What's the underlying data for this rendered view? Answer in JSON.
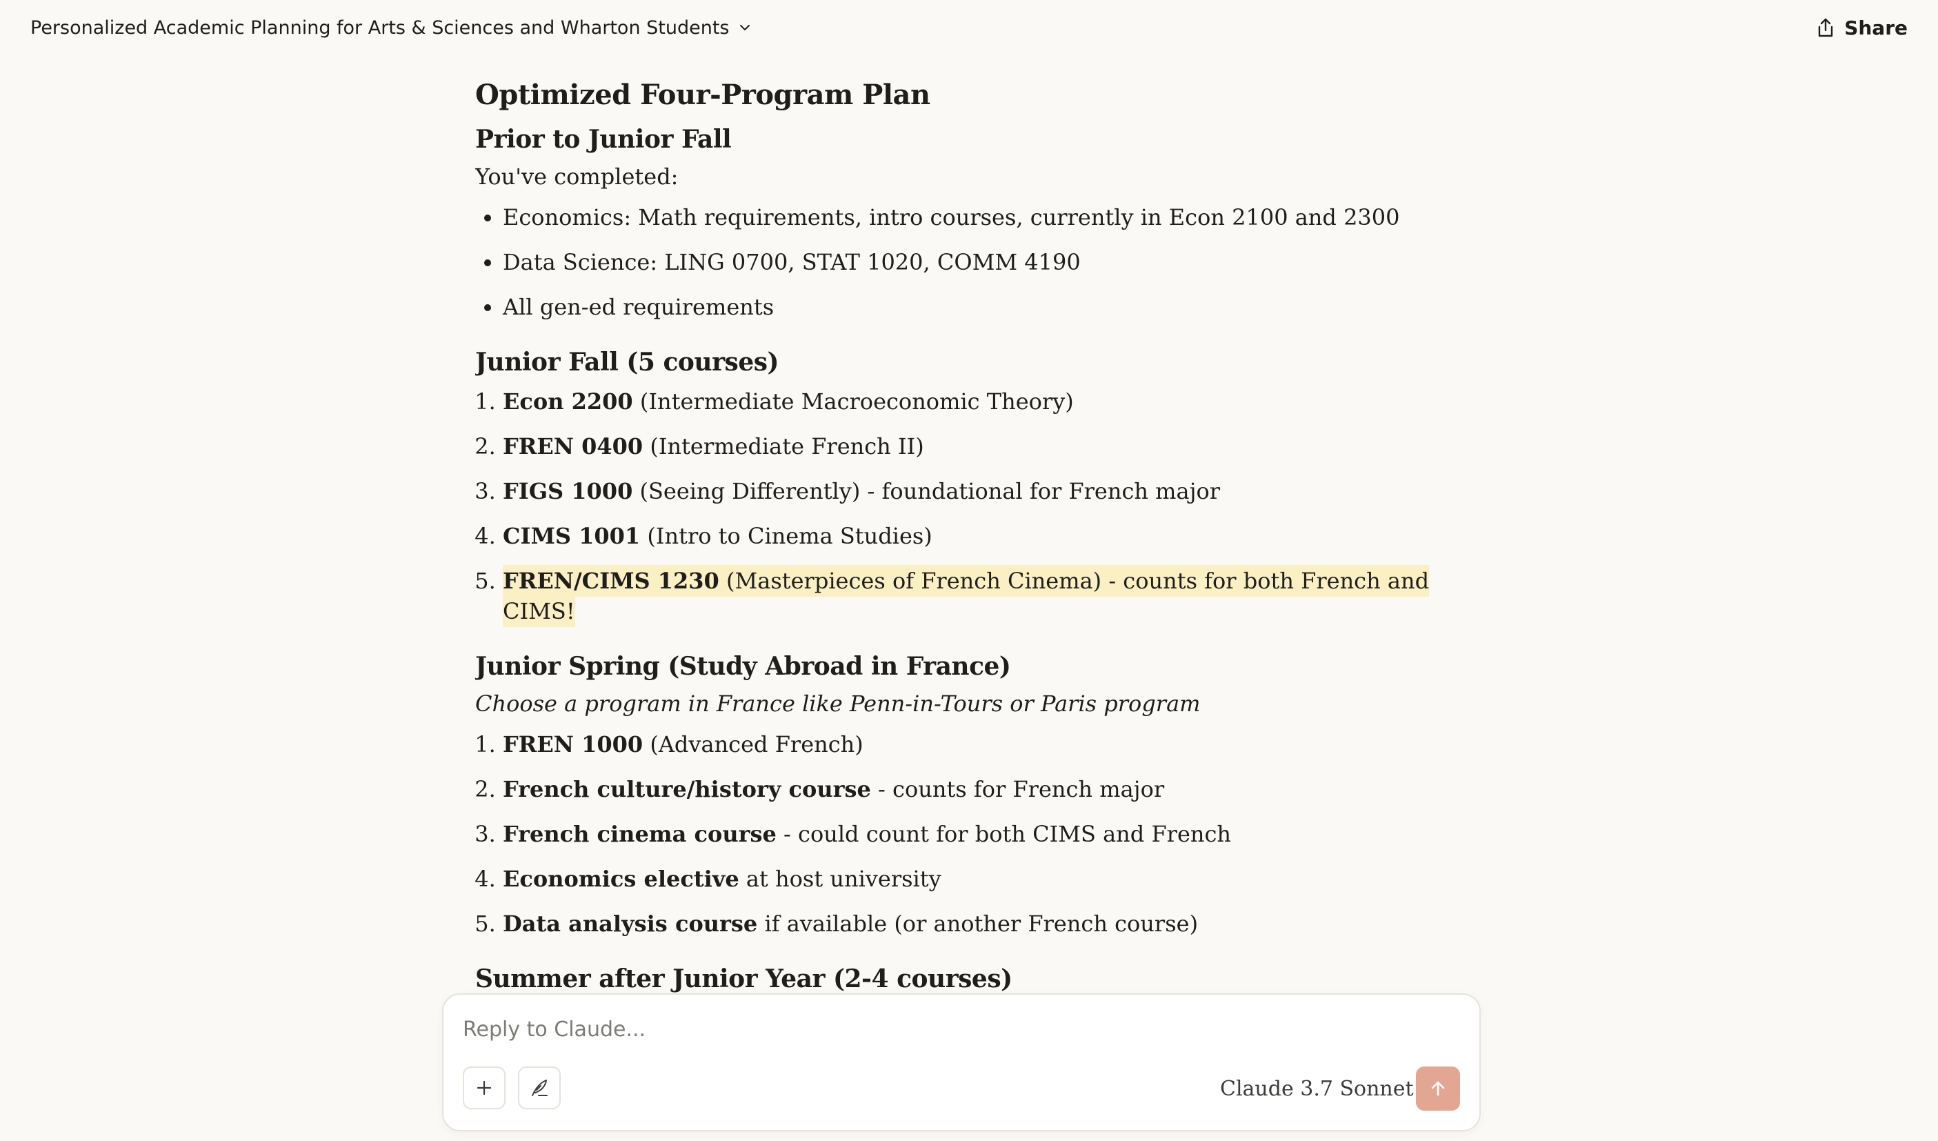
{
  "header": {
    "chat_title": "Personalized Academic Planning for Arts & Sciences and Wharton Students",
    "share_label": "Share"
  },
  "content": {
    "title": "Optimized Four-Program Plan",
    "prior": {
      "heading": "Prior to Junior Fall",
      "intro": "You've completed:",
      "items": [
        "Economics: Math requirements, intro courses, currently in Econ 2100 and 2300",
        "Data Science: LING 0700, STAT 1020, COMM 4190",
        "All gen-ed requirements"
      ]
    },
    "junior_fall": {
      "heading": "Junior Fall (5 courses)",
      "items": [
        {
          "num": "1.",
          "bold": "Econ 2200",
          "rest": " (Intermediate Macroeconomic Theory)"
        },
        {
          "num": "2.",
          "bold": "FREN 0400",
          "rest": " (Intermediate French II)"
        },
        {
          "num": "3.",
          "bold": "FIGS 1000",
          "rest": " (Seeing Differently) - foundational for French major"
        },
        {
          "num": "4.",
          "bold": "CIMS 1001",
          "rest": " (Intro to Cinema Studies)"
        },
        {
          "num": "5.",
          "bold": "FREN/CIMS 1230",
          "rest": " (Masterpieces of French Cinema) - counts for both French and CIMS!"
        }
      ]
    },
    "junior_spring": {
      "heading": "Junior Spring (Study Abroad in France)",
      "note": "Choose a program in France like Penn-in-Tours or Paris program",
      "items": [
        {
          "num": "1.",
          "bold": "FREN 1000",
          "rest": " (Advanced French)"
        },
        {
          "num": "2.",
          "bold": "French culture/history course",
          "rest": " - counts for French major"
        },
        {
          "num": "3.",
          "bold": "French cinema course",
          "rest": " - could count for both CIMS and French"
        },
        {
          "num": "4.",
          "bold": "Economics elective",
          "rest": " at host university"
        },
        {
          "num": "5.",
          "bold": "Data analysis course",
          "rest": " if available (or another French course)"
        }
      ]
    },
    "next_heading": "Summer after Junior Year (2-4 courses)"
  },
  "composer": {
    "placeholder": "Reply to Claude...",
    "model_label": "Claude 3.7 Sonnet"
  },
  "colors": {
    "background": "#faf9f5",
    "highlight": "#fbefc4",
    "send_button": "#e3a693"
  },
  "icons": {
    "title_dropdown": "chevron-down-icon",
    "share": "share-icon",
    "add": "plus-icon",
    "style": "quill-icon",
    "model_dropdown": "chevron-down-icon",
    "send": "arrow-up-icon"
  }
}
